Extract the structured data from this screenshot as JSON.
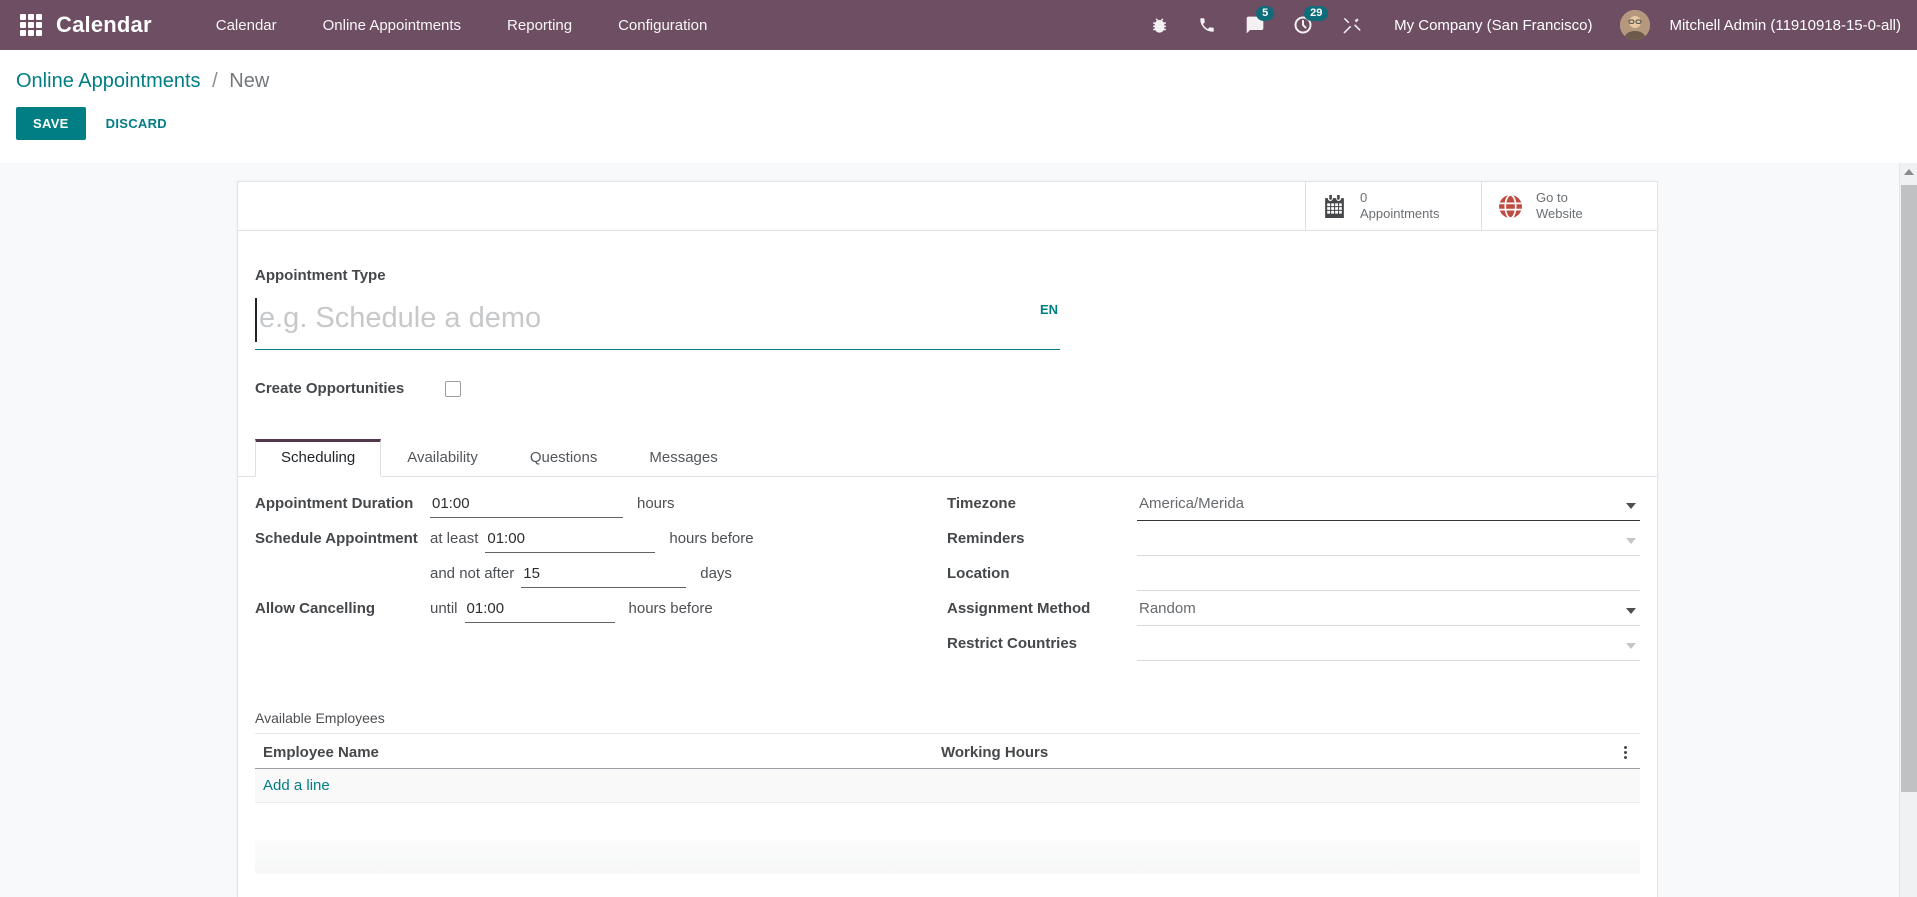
{
  "navbar": {
    "app_name": "Calendar",
    "menu": [
      "Calendar",
      "Online Appointments",
      "Reporting",
      "Configuration"
    ],
    "systray": {
      "message_count": "5",
      "activity_count": "29",
      "company": "My Company (San Francisco)",
      "user": "Mitchell Admin (11910918-15-0-all)"
    }
  },
  "control_panel": {
    "breadcrumb_parent": "Online Appointments",
    "breadcrumb_separator": "/",
    "breadcrumb_current": "New",
    "save": "SAVE",
    "discard": "DISCARD"
  },
  "button_box": {
    "appointments_value": "0",
    "appointments_label": "Appointments",
    "website_line1": "Go to",
    "website_line2": "Website"
  },
  "form": {
    "appointment_type_label": "Appointment Type",
    "appointment_type_placeholder": "e.g. Schedule a demo",
    "language": "EN",
    "create_opportunities_label": "Create Opportunities",
    "create_opportunities_checked": false,
    "tabs": [
      "Scheduling",
      "Availability",
      "Questions",
      "Messages"
    ],
    "fields_left": [
      {
        "label": "Appointment Duration",
        "prefix": "",
        "value": "01:00",
        "suffix": "hours"
      },
      {
        "label": "Schedule Appointment",
        "prefix": "at least",
        "value": "01:00",
        "suffix": "hours before"
      },
      {
        "label": "",
        "prefix": "and not after",
        "value": "15",
        "suffix": "days"
      },
      {
        "label": "Allow Cancelling",
        "prefix": "until",
        "value": "01:00",
        "suffix": "hours before"
      }
    ],
    "fields_right": [
      {
        "label": "Timezone",
        "value": "America/Merida"
      },
      {
        "label": "Reminders",
        "value": ""
      },
      {
        "label": "Location",
        "value": ""
      },
      {
        "label": "Assignment Method",
        "value": "Random"
      },
      {
        "label": "Restrict Countries",
        "value": ""
      }
    ],
    "employees_section": "Available Employees",
    "employees_columns": [
      "Employee Name",
      "Working Hours"
    ],
    "add_line": "Add a line"
  },
  "colors": {
    "navbar_bg": "#6e4e63",
    "primary_teal": "#017e84",
    "badge_teal": "#0e6d79",
    "active_tab_border": "#52374d",
    "globe_red": "#bf4b43"
  }
}
